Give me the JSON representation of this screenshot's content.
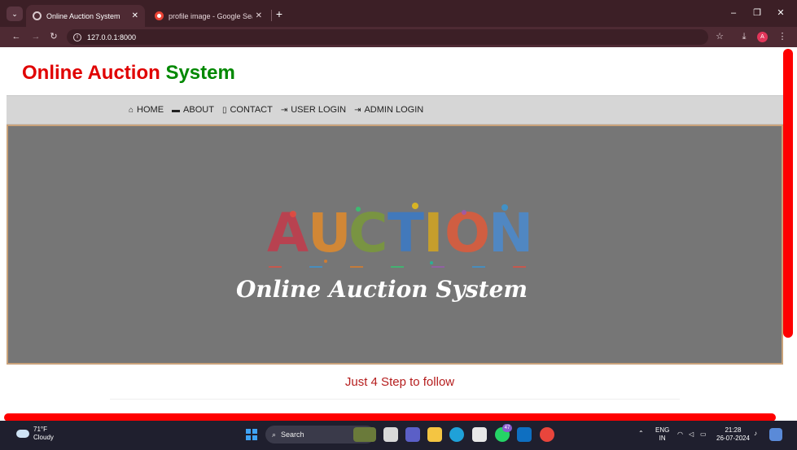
{
  "browser": {
    "tabs": [
      {
        "title": "Online Auction System",
        "active": true
      },
      {
        "title": "profile image - Google Search",
        "active": false
      }
    ],
    "new_tab": "+",
    "url": "127.0.0.1:8000",
    "profile_initial": "A"
  },
  "site": {
    "logo_part1": "Online Auction",
    "logo_part2": "System",
    "nav": [
      {
        "label": "HOME",
        "icon": "home-icon"
      },
      {
        "label": "ABOUT",
        "icon": "briefcase-icon"
      },
      {
        "label": "CONTACT",
        "icon": "phone-icon"
      },
      {
        "label": "USER LOGIN",
        "icon": "login-icon"
      },
      {
        "label": "ADMIN LOGIN",
        "icon": "login-icon"
      }
    ],
    "hero_caption": "Online Auction System",
    "steps_title": "Just 4 Step to follow"
  },
  "colors": {
    "logo_red": "#e00000",
    "logo_green": "#008800",
    "steps_title": "#b51d1d",
    "scrollbar": "#ff0000",
    "chrome": "#3c1f26"
  },
  "taskbar": {
    "temp": "71°F",
    "condition": "Cloudy",
    "search": "Search",
    "badge": "47",
    "lang1": "ENG",
    "lang2": "IN",
    "time": "21:28",
    "date": "26-07-2024"
  }
}
